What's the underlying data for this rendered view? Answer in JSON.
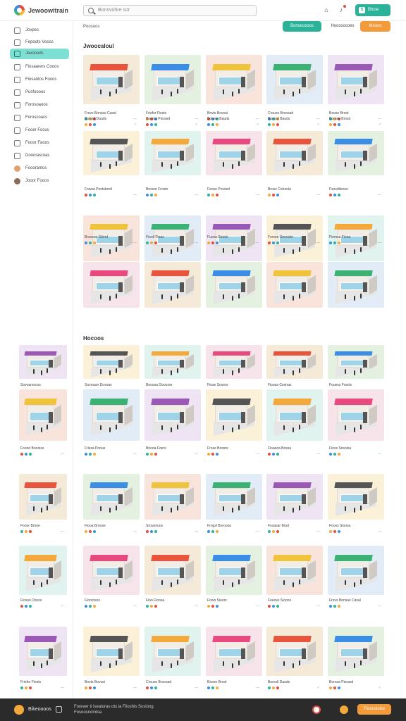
{
  "app": {
    "name": "Jewoowitrain"
  },
  "header": {
    "search_placeholder": "Bonsvohre sor",
    "action_label": "Bhcte",
    "action_glyph": "S"
  },
  "sidebar": {
    "items": [
      {
        "label": "Jovpes",
        "icon": "home-icon"
      },
      {
        "label": "Fepoots Vooss",
        "icon": "grid-icon"
      },
      {
        "label": "Javooods",
        "icon": "store-icon",
        "active": true
      },
      {
        "label": "Fiosaarers Cooos",
        "icon": "calendar-icon"
      },
      {
        "label": "Fiosantos Fooos",
        "icon": "list-icon"
      },
      {
        "label": "Pusfoooos",
        "icon": "document-icon"
      },
      {
        "label": "Forosoaoos",
        "icon": "clock-icon"
      },
      {
        "label": "Foroscoacs",
        "icon": "chart-icon"
      },
      {
        "label": "Fooer Focus",
        "icon": "table-icon"
      },
      {
        "label": "Fooor Faoos",
        "icon": "folder-icon"
      },
      {
        "label": "Dooorasroas",
        "icon": "tag-icon"
      },
      {
        "label": "Fooorantos",
        "icon": "user-icon"
      },
      {
        "label": "Jooor Fooos",
        "icon": "avatar-icon"
      }
    ]
  },
  "main": {
    "breadcrumb": "Poosoos",
    "btn_primary": "Bonsoocoos",
    "btn_secondary": "Hoossocoes",
    "btn_accent": "Mooos",
    "section1_title": "Jwoocaloul",
    "section2_title": "Hocoos"
  },
  "cards": [
    {
      "title": "Frevs Bonsas Casal",
      "meta": "—"
    },
    {
      "title": "Friefor Fiests",
      "meta": "—"
    },
    {
      "title": "Bnvts Bovsai",
      "meta": "—"
    },
    {
      "title": "Crouse Broosad",
      "meta": "—"
    },
    {
      "title": "Bxooo Broot",
      "meta": "—"
    },
    {
      "title": "Borosil Dauds",
      "meta": "✓"
    },
    {
      "title": "Borosa Piorasd",
      "meta": "✓"
    },
    {
      "title": "Borose Bauds",
      "meta": "✓"
    },
    {
      "title": "Borosd Bauds",
      "meta": "✓"
    },
    {
      "title": "Borose Brosd",
      "meta": "✓"
    },
    {
      "title": "Fowsa Pootsbord",
      "meta": "—"
    },
    {
      "title": "Bresee Frosto",
      "meta": "—"
    },
    {
      "title": "Feose Prosiorl",
      "meta": "—"
    },
    {
      "title": "Bross Cohoola",
      "meta": "—"
    },
    {
      "title": "Fsosdilenoo",
      "meta": "—"
    },
    {
      "title": "Brossoe Sttord",
      "meta": "—"
    },
    {
      "title": "Fiooil Fioas",
      "meta": "—"
    },
    {
      "title": "Fuosa Stoots",
      "meta": "—"
    },
    {
      "title": "Forsee Smoorte",
      "meta": "—"
    },
    {
      "title": "Fiomsa Fiooa",
      "meta": "—"
    },
    {
      "title": "Sovoarsocos",
      "meta": "—"
    },
    {
      "title": "Sovroaor Dovoas",
      "meta": "—"
    },
    {
      "title": "Bnoosa Gooorse",
      "meta": "—"
    },
    {
      "title": "Fiose Sooros",
      "meta": "—"
    },
    {
      "title": "Fioosa Cesnas",
      "meta": "—"
    },
    {
      "title": "Fouess Foorts",
      "meta": "—"
    },
    {
      "title": "Foorel Boooiss",
      "meta": "—"
    },
    {
      "title": "Frissa Pooue",
      "meta": "—"
    },
    {
      "title": "Briooa Foers",
      "meta": "—"
    },
    {
      "title": "Frose Bossre",
      "meta": "—"
    },
    {
      "title": "Fioasoa Bossa",
      "meta": "—"
    },
    {
      "title": "Fioss Sosoisa",
      "meta": "—"
    },
    {
      "title": "Fooor Brooe",
      "meta": "—"
    },
    {
      "title": "Fiooa Broose",
      "meta": "—"
    },
    {
      "title": "Srouorioos",
      "meta": "—"
    },
    {
      "title": "Frogsl Boroosa",
      "meta": "—"
    },
    {
      "title": "Fosasar Brod",
      "meta": "—"
    },
    {
      "title": "Fooss Sioosa",
      "meta": "—"
    },
    {
      "title": "Fiosse Dooss",
      "meta": "—"
    },
    {
      "title": "Fioorosos",
      "meta": "—"
    },
    {
      "title": "Fioo Fioosa",
      "meta": "—"
    },
    {
      "title": "Fowo Sioors",
      "meta": "—"
    },
    {
      "title": "Foeoss Siooos",
      "meta": "—"
    }
  ],
  "footer": {
    "brand": "Bikeoooos",
    "text_line1": "Forever ti Iseaioras ots ia Fiioshis Sosiong",
    "text_line2": "Fosoosnoinloa",
    "button_label": "Flooosioiss"
  },
  "colors": {
    "accent": "#2bb39a",
    "orange": "#f39a3b",
    "active_nav": "#7ee0d3",
    "footer_bg": "#2b2b2b"
  }
}
